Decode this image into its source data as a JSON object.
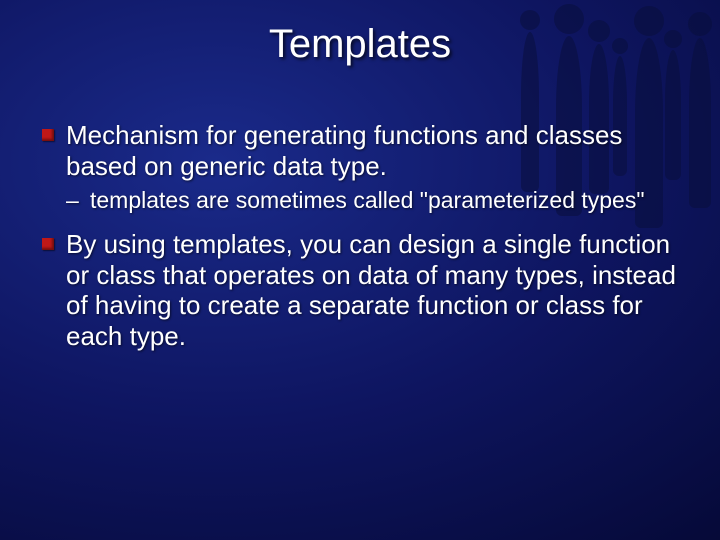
{
  "title": "Templates",
  "bullets": {
    "b1": "Mechanism for generating functions and classes based on generic data type.",
    "b1_sub": "templates are sometimes called \"parameterized types\"",
    "b2": "By using templates, you can design a single function or class that operates on data of many types, instead of having to create a separate function or class for each type."
  }
}
